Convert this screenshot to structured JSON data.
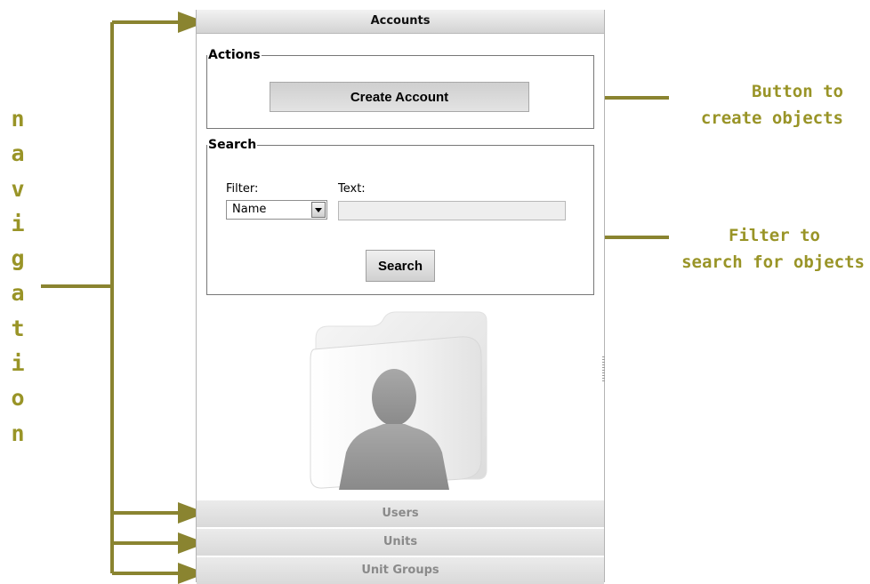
{
  "panel": {
    "active_section": "Accounts",
    "actions": {
      "legend": "Actions",
      "create_button": "Create Account"
    },
    "search": {
      "legend": "Search",
      "filter_label": "Filter:",
      "filter_value": "Name",
      "text_label": "Text:",
      "text_value": "",
      "search_button": "Search"
    },
    "illustration_icon": "account-silhouette-icon",
    "collapsed_sections": [
      "Users",
      "Units",
      "Unit Groups"
    ]
  },
  "annotations": {
    "navigation_letters": [
      "n",
      "a",
      "v",
      "i",
      "g",
      "a",
      "t",
      "i",
      "o",
      "n"
    ],
    "button_note": [
      "Button to",
      "create objects"
    ],
    "filter_note": [
      "Filter to",
      "search for objects"
    ],
    "color": "#999427"
  }
}
